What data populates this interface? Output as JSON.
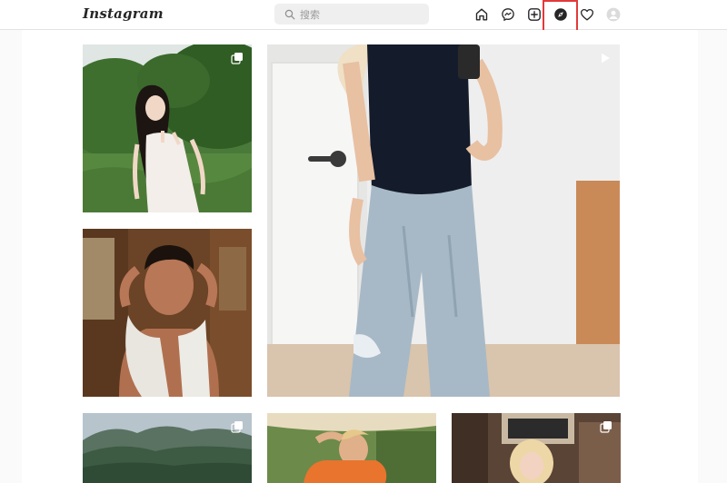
{
  "header": {
    "logo": "Instagram",
    "search_placeholder": "搜索",
    "icons": [
      "home-icon",
      "messenger-icon",
      "new-post-icon",
      "explore-icon",
      "activity-heart-icon",
      "profile-avatar-icon"
    ],
    "active_icon": "explore-icon",
    "highlight_color": "#e23a3a"
  },
  "explore_grid": {
    "tiles": [
      {
        "name": "post-woman-white-dress",
        "badge": "multi-photo-icon"
      },
      {
        "name": "post-man-towel",
        "badge": null
      },
      {
        "name": "reel-woman-mirror-selfie",
        "badge": "reel-play-icon"
      },
      {
        "name": "post-mountains",
        "badge": "multi-photo-icon"
      },
      {
        "name": "post-woman-orange-shirt",
        "badge": null
      },
      {
        "name": "post-blonde-woman-sign",
        "badge": "multi-photo-icon"
      }
    ]
  }
}
